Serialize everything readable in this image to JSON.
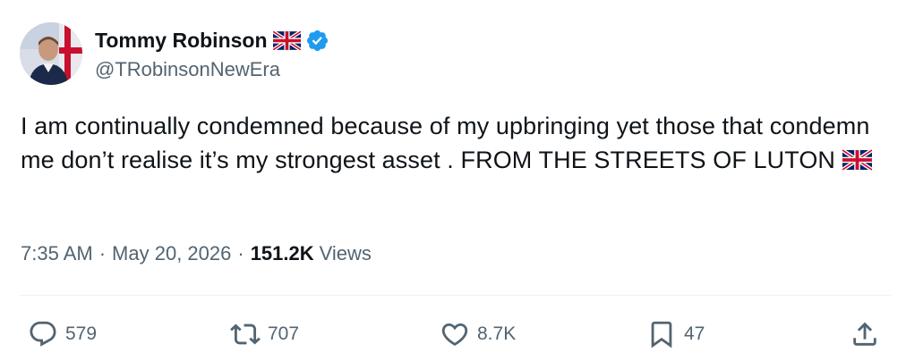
{
  "author": {
    "display_name": "Tommy Robinson",
    "handle": "@TRobinsonNewEra",
    "flag_icon": "uk-flag-icon",
    "verified_icon": "verified-badge-icon",
    "verified_color": "#1d9bf0"
  },
  "tweet": {
    "text": "I am continually condemned because of my upbringing yet those that condemn me don’t realise it’s my strongest asset . FROM THE STREETS OF LUTON",
    "time": "7:35 AM",
    "date": "May 20, 2026",
    "views_count": "151.2K",
    "views_label": "Views"
  },
  "actions": {
    "reply": {
      "icon": "reply-icon",
      "count": "579"
    },
    "retweet": {
      "icon": "retweet-icon",
      "count": "707"
    },
    "like": {
      "icon": "heart-icon",
      "count": "8.7K"
    },
    "bookmark": {
      "icon": "bookmark-icon",
      "count": "47"
    },
    "share": {
      "icon": "share-icon"
    }
  },
  "colors": {
    "text_primary": "#0f1419",
    "text_secondary": "#536471",
    "divider": "#eff3f4"
  }
}
